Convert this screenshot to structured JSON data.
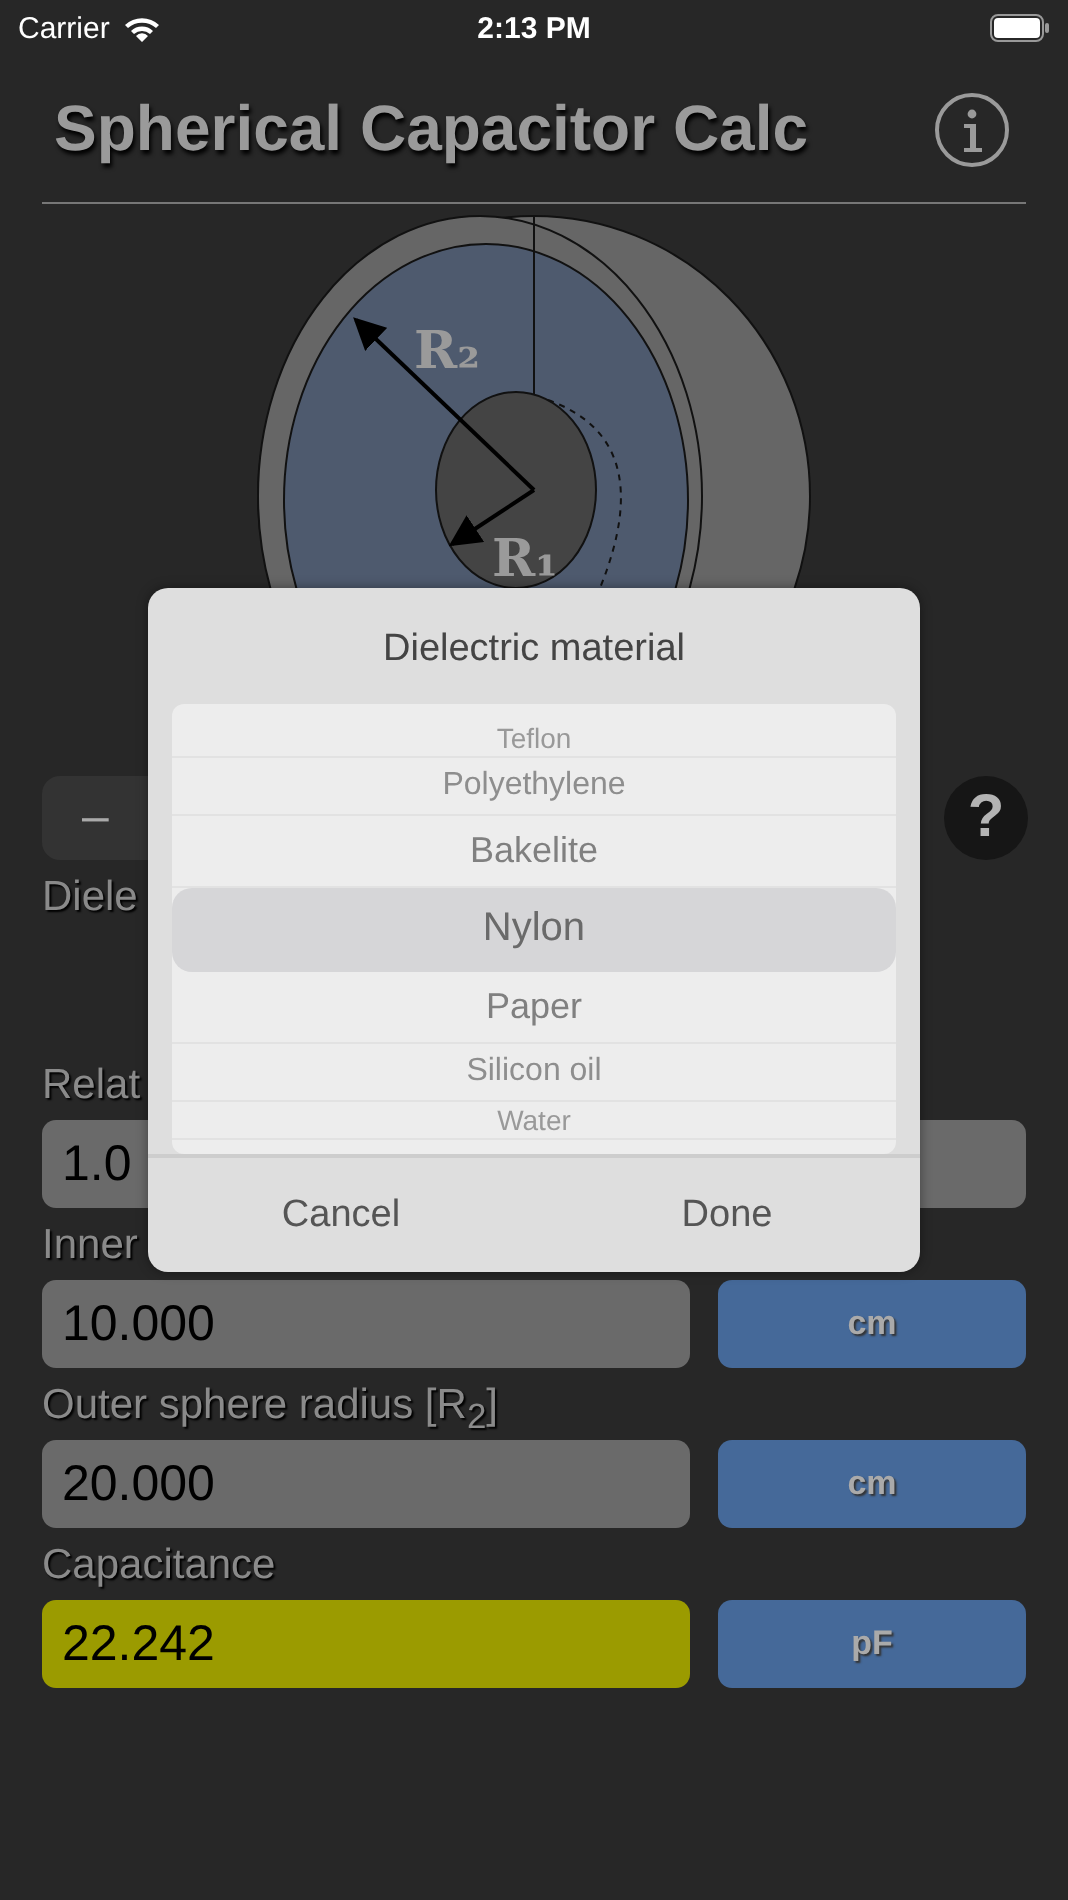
{
  "status_bar": {
    "carrier": "Carrier",
    "time": "2:13 PM"
  },
  "title": "Spherical Capacitor Calc",
  "diagram": {
    "outer_label": "R₂",
    "inner_label": "R₁"
  },
  "stepper": {
    "minus": "–"
  },
  "help_button": "?",
  "dielectric_label": "Diele",
  "fields": [
    {
      "label": "Relat",
      "value": "1.0",
      "kind": "input"
    },
    {
      "label": "Inner",
      "value": "10.000",
      "unit": "cm",
      "kind": "input"
    },
    {
      "label": "Outer sphere radius [R$_{2}$]",
      "value": "20.000",
      "unit": "cm",
      "kind": "input"
    },
    {
      "label": "Capacitance",
      "value": "22.242",
      "unit": "pF",
      "kind": "result"
    }
  ],
  "dialog": {
    "title": "Dielectric material",
    "options": [
      {
        "label": "Teflon",
        "selected": false
      },
      {
        "label": "Polyethylene",
        "selected": false
      },
      {
        "label": "Bakelite",
        "selected": false
      },
      {
        "label": "Nylon",
        "selected": true
      },
      {
        "label": "Paper",
        "selected": false
      },
      {
        "label": "Silicon oil",
        "selected": false
      },
      {
        "label": "Water",
        "selected": false
      }
    ],
    "buttons": [
      "Cancel",
      "Done"
    ]
  }
}
